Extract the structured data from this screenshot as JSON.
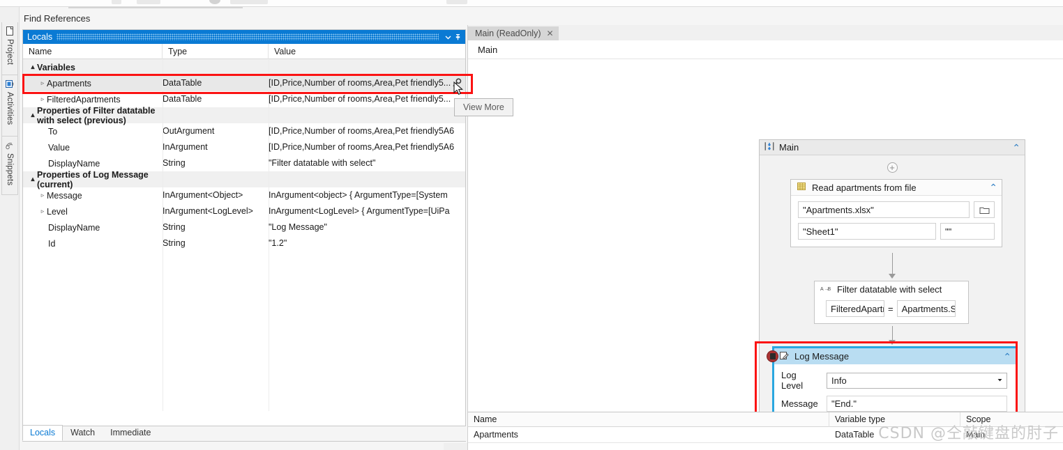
{
  "window": {
    "find_references_label": "Find References"
  },
  "rail": {
    "items": [
      {
        "label": "Project",
        "icon": "document-icon"
      },
      {
        "label": "Activities",
        "icon": "activities-icon"
      },
      {
        "label": "Snippets",
        "icon": "snippets-icon"
      }
    ]
  },
  "locals": {
    "title": "Locals",
    "dropdown_icon": "chevron-down-icon",
    "pin_icon": "pin-icon",
    "columns": [
      "Name",
      "Type",
      "Value"
    ],
    "rows": [
      {
        "kind": "group",
        "indent": 1,
        "expander": "▴",
        "name": "Variables",
        "type": "",
        "value": ""
      },
      {
        "kind": "item",
        "indent": 2,
        "expander": "▹",
        "name": "Apartments",
        "type": "DataTable",
        "value": "[ID,Price,Number of rooms,Area,Pet friendly5...",
        "selected": true,
        "view_more": true
      },
      {
        "kind": "item",
        "indent": 2,
        "expander": "▹",
        "name": "FilteredApartments",
        "type": "DataTable",
        "value": "[ID,Price,Number of rooms,Area,Pet friendly5..."
      },
      {
        "kind": "group",
        "indent": 1,
        "expander": "▴",
        "name": "Properties of Filter datatable with select (previous)",
        "type": "",
        "value": ""
      },
      {
        "kind": "item",
        "indent": 3,
        "expander": "",
        "name": "To",
        "type": "OutArgument",
        "value": "[ID,Price,Number of rooms,Area,Pet friendly5A6"
      },
      {
        "kind": "item",
        "indent": 3,
        "expander": "",
        "name": "Value",
        "type": "InArgument",
        "value": "[ID,Price,Number of rooms,Area,Pet friendly5A6"
      },
      {
        "kind": "item",
        "indent": 3,
        "expander": "",
        "name": "DisplayName",
        "type": "String",
        "value": "\"Filter datatable with select\""
      },
      {
        "kind": "group",
        "indent": 1,
        "expander": "▴",
        "name": "Properties of Log Message (current)",
        "type": "",
        "value": ""
      },
      {
        "kind": "item",
        "indent": 2,
        "expander": "▹",
        "name": "Message",
        "type": "InArgument<Object>",
        "value": "InArgument<object> { ArgumentType=[System"
      },
      {
        "kind": "item",
        "indent": 2,
        "expander": "▹",
        "name": "Level",
        "type": "InArgument<LogLevel>",
        "value": "InArgument<LogLevel> { ArgumentType=[UiPa"
      },
      {
        "kind": "item",
        "indent": 3,
        "expander": "",
        "name": "DisplayName",
        "type": "String",
        "value": "\"Log Message\""
      },
      {
        "kind": "item",
        "indent": 3,
        "expander": "",
        "name": "Id",
        "type": "String",
        "value": "\"1.2\""
      }
    ],
    "tabs": [
      {
        "label": "Locals",
        "active": true
      },
      {
        "label": "Watch",
        "active": false
      },
      {
        "label": "Immediate",
        "active": false
      }
    ]
  },
  "tooltip": {
    "view_more_label": "View More"
  },
  "designer": {
    "document_tab": {
      "label": "Main (ReadOnly)",
      "close_icon": "close-icon"
    },
    "breadcrumb": "Main",
    "sequence": {
      "title": "Main",
      "icon": "sequence-icon",
      "collapse_icon": "chevron-up-icon",
      "add_icon": "plus-icon"
    },
    "activities": [
      {
        "id": "read-apartments",
        "title": "Read apartments from file",
        "icon": "excel-icon",
        "collapse_icon": "chevron-up-icon",
        "fields": [
          {
            "name": "workbook-path",
            "value": "\"Apartments.xlsx\""
          },
          {
            "name": "sheet-name",
            "value": "\"Sheet1\""
          },
          {
            "name": "range",
            "value": "\"\""
          }
        ],
        "browse_icon": "folder-icon"
      },
      {
        "id": "filter-datatable",
        "title": "Filter datatable with select",
        "icon": "assign-icon",
        "left_value": "FilteredApartment:",
        "operator": "=",
        "right_value": "Apartments.Select("
      },
      {
        "id": "log-message",
        "title": "Log Message",
        "icon": "log-message-icon",
        "collapse_icon": "chevron-up-icon",
        "breakpoint_icon": "breakpoint-icon",
        "selected": true,
        "fields": [
          {
            "label": "Log Level",
            "name": "log-level-combo",
            "value": "Info",
            "dropdown_icon": "chevron-down-icon"
          },
          {
            "label": "Message",
            "name": "message-input",
            "value": "\"End.\""
          }
        ]
      }
    ]
  },
  "variables_panel": {
    "columns": [
      "Name",
      "Variable type",
      "Scope"
    ],
    "rows": [
      {
        "name": "Apartments",
        "type": "DataTable",
        "scope": "Main"
      }
    ]
  },
  "watermark": {
    "text": "CSDN @仝敲键盘的肘子"
  },
  "colors": {
    "title_blue": "#0a7ad4",
    "selection_blue": "#2aa7e0",
    "annotation_red": "#fb1313",
    "header_light_blue": "#b9ddf2"
  }
}
